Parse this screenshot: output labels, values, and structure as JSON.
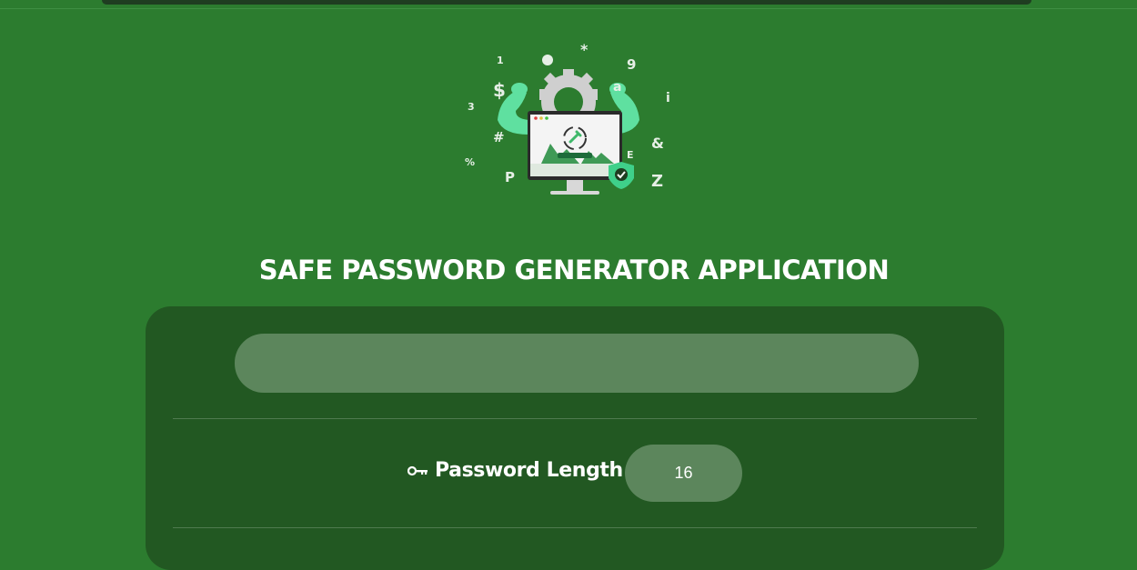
{
  "app": {
    "title": "SAFE PASSWORD GENERATOR APPLICATION"
  },
  "hero": {
    "icon": "password-generator-illustration",
    "floating_chars": [
      "1",
      "*",
      "9",
      "$",
      "a",
      "i",
      "3",
      "#",
      "E",
      "&",
      "%",
      "P",
      "Z"
    ]
  },
  "password_output": {
    "value": ""
  },
  "length": {
    "label": "Password Length",
    "icon": "key-icon",
    "value": "16"
  },
  "colors": {
    "background": "#2c7c2f",
    "panel": "#225822",
    "field": "#5c865c",
    "accent": "#5fe0a0",
    "text": "#ffffff"
  }
}
